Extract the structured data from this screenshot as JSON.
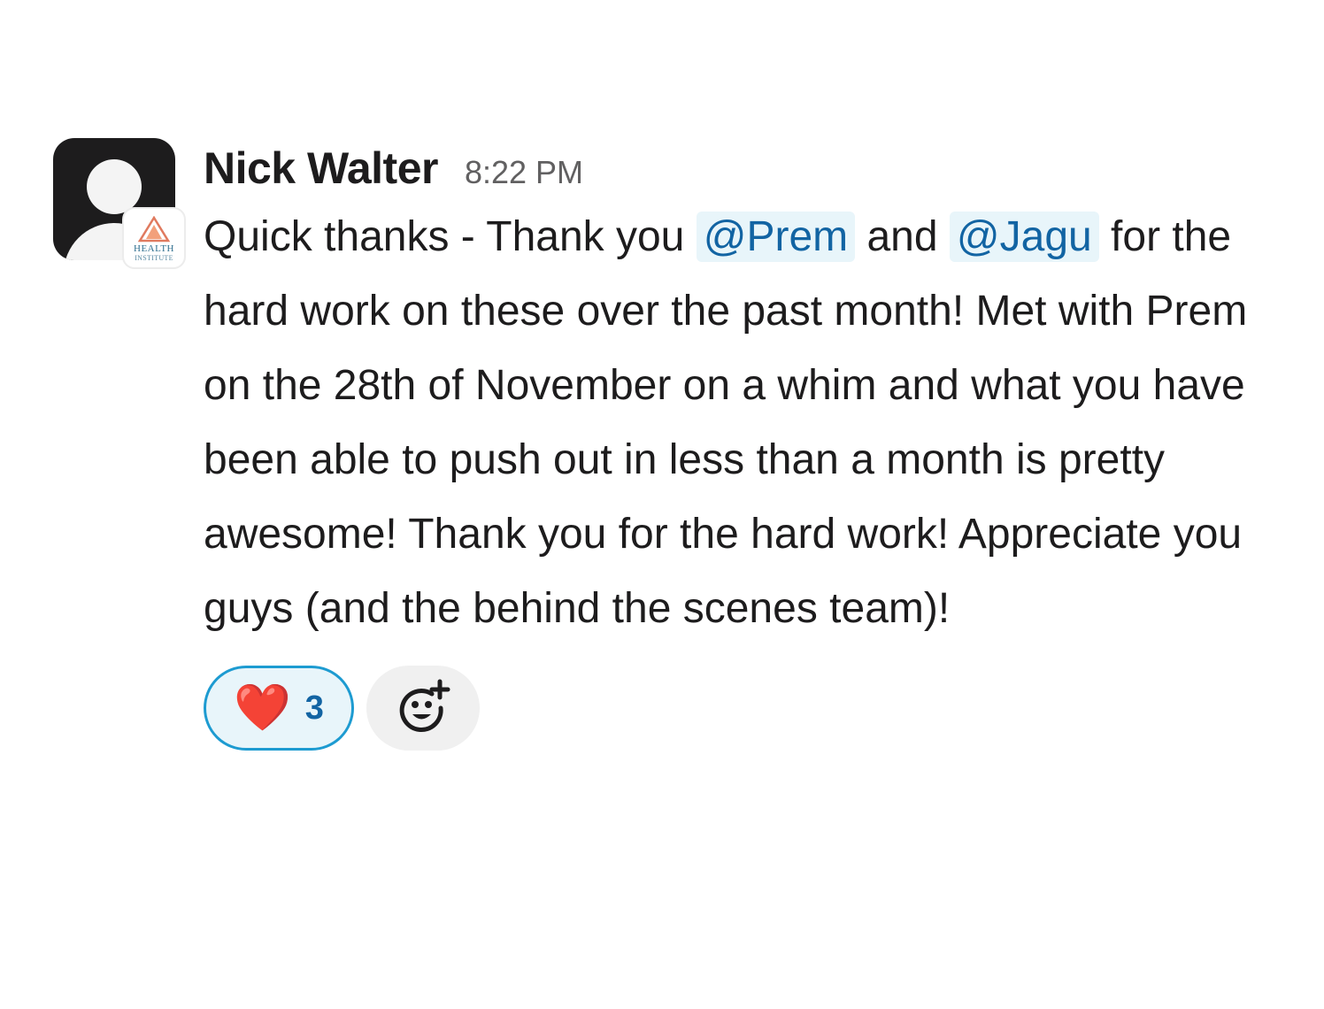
{
  "message": {
    "author": "Nick Walter",
    "timestamp": "8:22 PM",
    "org_badge": {
      "line1": "HEALTH",
      "line2": "INSTITUTE"
    },
    "text": {
      "part1": "Quick thanks - Thank you ",
      "mention1": "@Prem",
      "part2": " and ",
      "mention2": "@Jagu",
      "part3": " for the hard work on these over the past month! Met with Prem on the 28th of November on a whim and what you have been able to push out in less than a month is pretty awesome! Thank you for the hard work! Appreciate you guys (and the behind the scenes team)!"
    },
    "reactions": [
      {
        "emoji": "❤️",
        "icon": "heart-emoji",
        "count": "3",
        "selected": true
      }
    ],
    "add_reaction_icon": "add-reaction-icon"
  },
  "colors": {
    "mention_bg": "#e8f5fa",
    "mention_text": "#1264a3",
    "reaction_border": "#1d9bd1",
    "heart": "#e0182d"
  }
}
